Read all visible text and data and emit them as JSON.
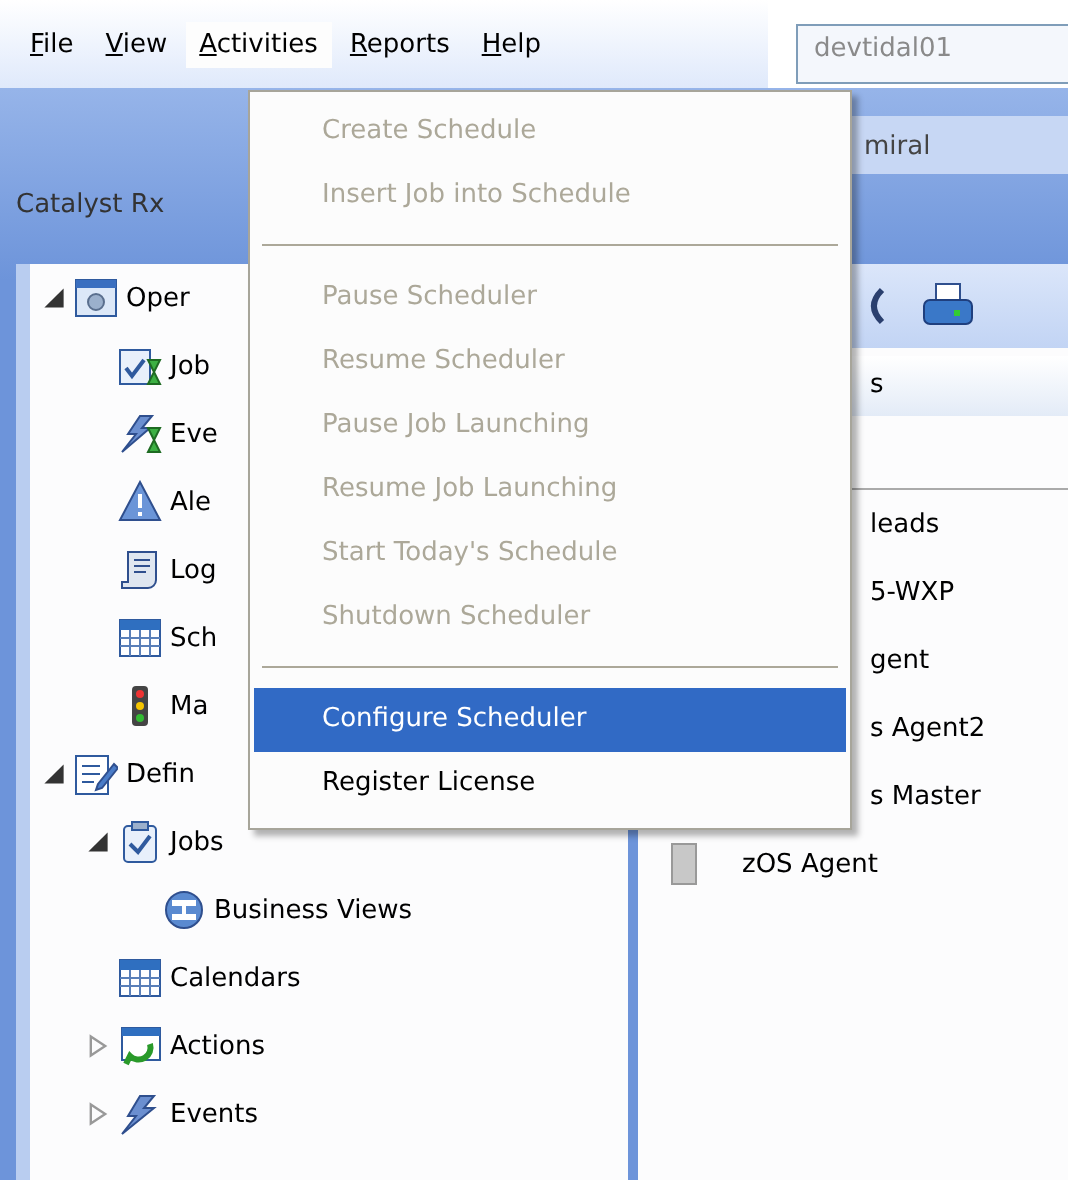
{
  "menubar": {
    "items": [
      {
        "label": "File",
        "selected": false
      },
      {
        "label": "View",
        "selected": false
      },
      {
        "label": "Activities",
        "selected": true
      },
      {
        "label": "Reports",
        "selected": false
      },
      {
        "label": "Help",
        "selected": false
      }
    ]
  },
  "server_field": {
    "value": "devtidal01"
  },
  "tab": {
    "label": "miral"
  },
  "panel_title": "Catalyst Rx",
  "tree": [
    {
      "label": "Oper",
      "kind": "operations",
      "expanded": true,
      "children": [
        {
          "label": "Job",
          "kind": "job-activity"
        },
        {
          "label": "Eve",
          "kind": "event-activity"
        },
        {
          "label": "Ale",
          "kind": "alerts"
        },
        {
          "label": "Log",
          "kind": "logs"
        },
        {
          "label": "Sch",
          "kind": "schedules"
        },
        {
          "label": "Ma",
          "kind": "masters"
        }
      ]
    },
    {
      "label": "Defin",
      "kind": "definitions",
      "expanded": true,
      "children": [
        {
          "label": "Jobs",
          "kind": "jobs",
          "expanded": true,
          "children": [
            {
              "label": "Business Views",
              "kind": "business-views"
            }
          ]
        },
        {
          "label": "Calendars",
          "kind": "calendars"
        },
        {
          "label": "Actions",
          "kind": "actions",
          "expanded": false
        },
        {
          "label": "Events",
          "kind": "events",
          "expanded": false
        }
      ]
    }
  ],
  "right_header": "s",
  "right_rows": [
    {
      "label": "leads",
      "covered": true
    },
    {
      "label": "5-WXP",
      "covered": true
    },
    {
      "label": "gent",
      "covered": true
    },
    {
      "label": "s Agent2",
      "covered": true
    },
    {
      "label": "s Master",
      "covered": true
    },
    {
      "label": "zOS Agent",
      "covered": false
    }
  ],
  "menu": {
    "items": [
      {
        "kind": "item",
        "label": "Create Schedule",
        "disabled": true,
        "selected": false
      },
      {
        "kind": "item",
        "label": "Insert Job into Schedule",
        "disabled": true,
        "selected": false
      },
      {
        "kind": "separator"
      },
      {
        "kind": "item",
        "label": "Pause Scheduler",
        "disabled": true,
        "selected": false
      },
      {
        "kind": "item",
        "label": "Resume Scheduler",
        "disabled": true,
        "selected": false
      },
      {
        "kind": "item",
        "label": "Pause Job Launching",
        "disabled": true,
        "selected": false
      },
      {
        "kind": "item",
        "label": "Resume Job Launching",
        "disabled": true,
        "selected": false
      },
      {
        "kind": "item",
        "label": "Start Today's Schedule",
        "disabled": true,
        "selected": false
      },
      {
        "kind": "item",
        "label": "Shutdown Scheduler",
        "disabled": true,
        "selected": false
      },
      {
        "kind": "separator"
      },
      {
        "kind": "item",
        "label": "Configure Scheduler",
        "disabled": false,
        "selected": true
      },
      {
        "kind": "item",
        "label": "Register License",
        "disabled": false,
        "selected": false
      }
    ]
  }
}
